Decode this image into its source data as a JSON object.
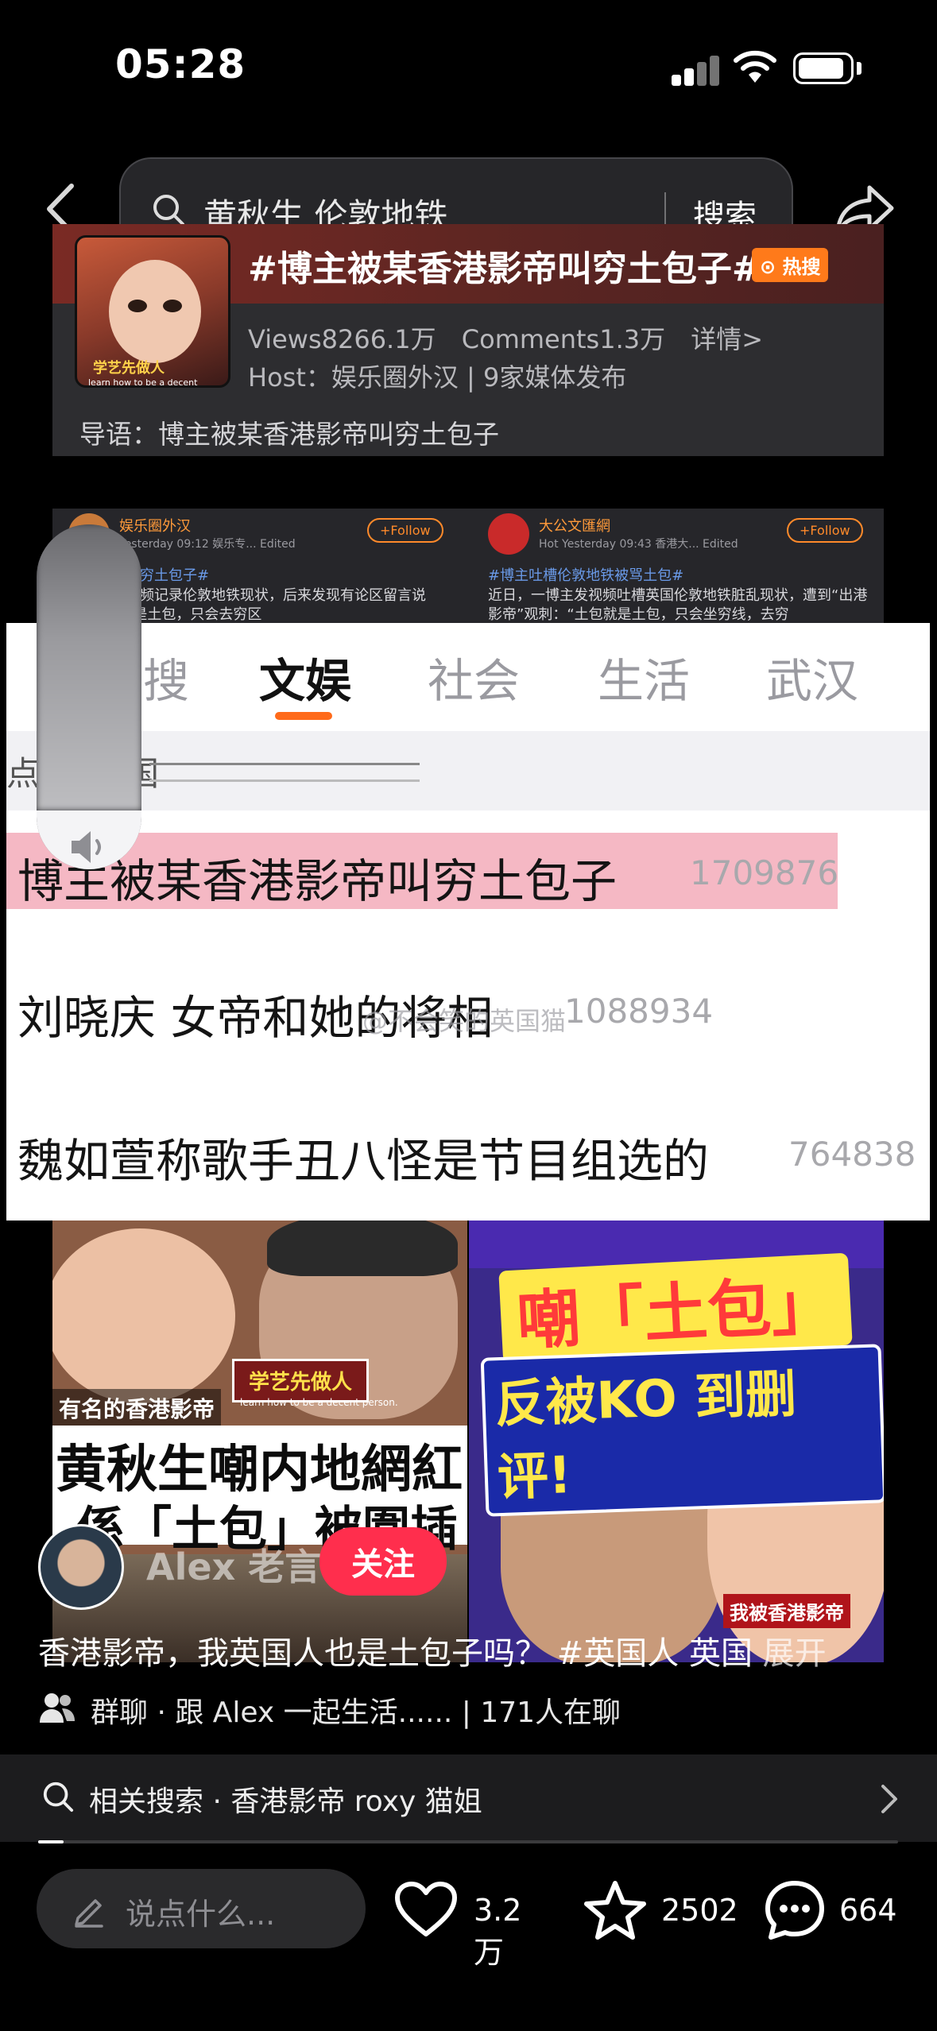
{
  "status_bar": {
    "time": "05:28"
  },
  "search": {
    "query": "黄秋生 伦敦地铁",
    "button": "搜索"
  },
  "topic": {
    "title": "#博主被某香港影帝叫穷土包子#",
    "hot_badge": "热搜",
    "views": "Views8266.1万",
    "comments": "Comments1.3万",
    "details": "详情>",
    "host": "Host：娱乐圈外汉 | 9家媒体发布",
    "intro": "导语：博主被某香港影帝叫穷土包子",
    "thumb_caption": "学艺先做人",
    "thumb_caption_en": "learn how to be a decent person"
  },
  "posts": [
    {
      "name": "娱乐圈外汉",
      "meta": "Yesterday 09:12  娱乐专...  Edited",
      "follow": "+Follow",
      "tag": "香港影帝叫穷土包子#",
      "body": "交平台发视频记录伦敦地铁现状，后来发现有论区留言说她“土包就是土包，只会去穷区"
    },
    {
      "name": "大公文匯網",
      "meta": "Hot  Yesterday 09:43  香港大...  Edited",
      "follow": "+Follow",
      "tag": "#博主吐槽伦敦地铁被骂土包#",
      "body": "近日，一博主发视频吐槽英国伦敦地铁脏乱现状，遭到“出港影帝”观刺：“土包就是土包，只会坐穷线，去穷"
    }
  ],
  "trend_panel": {
    "tabs": [
      "热搜",
      "文娱",
      "社会",
      "生活",
      "武汉"
    ],
    "tabs_visible": [
      "搜",
      "文娱",
      "社会",
      "生活",
      "武汉"
    ],
    "active_tab": "文娱",
    "header": "点",
    "header2": "国",
    "rows": [
      {
        "title": "博主被某香港影帝叫穷土包子",
        "count": "1709876"
      },
      {
        "title": "刘晓庆 女帝和她的将相",
        "count": "1088934"
      },
      {
        "title": "魏如萱称歌手丑八怪是节目组选的",
        "count": "764838"
      }
    ],
    "watermark": "@不会笑的英国猫"
  },
  "thumbnails": {
    "left": {
      "label1": "学艺先做人",
      "label1_en": "learn how to be a decent person.",
      "label2": "有名的香港影帝",
      "headline1": "黄秋生嘲内地網紅",
      "headline2": "係「土包」被圍插"
    },
    "right": {
      "headline1": "嘲「土包」",
      "headline2": "反被KO 到删评!",
      "label": "我被香港影帝"
    }
  },
  "author": {
    "name": "Alex 老言",
    "follow": "关注"
  },
  "video_caption": "香港影帝，我英国人也是土包子吗？ #英国人 英国",
  "video_caption_more": "展开",
  "group_chat": "群聊 · 跟 Alex 一起生活...... | 171人在聊",
  "related_search": "相关搜索 · 香港影帝 roxy 猫姐",
  "progress": 0.03,
  "bottom_bar": {
    "comment_placeholder": "说点什么...",
    "likes": "3.2万",
    "favorites": "2502",
    "comments": "664"
  },
  "colors": {
    "accent": "#ff2e4d",
    "tab_underline": "#ff6a1a",
    "hot_badge": "#ff7a1a",
    "highlight": "#f5b8c4"
  },
  "icons": [
    "back-icon",
    "share-icon",
    "search-icon",
    "volume-icon",
    "group-icon",
    "chevron-right-icon",
    "pen-icon",
    "heart-icon",
    "star-icon",
    "comment-icon"
  ]
}
